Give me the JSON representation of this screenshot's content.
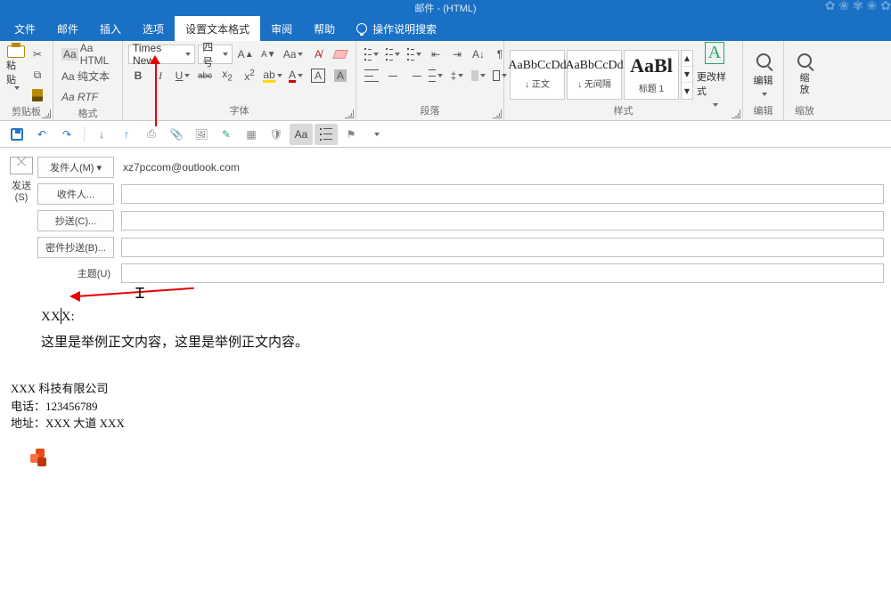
{
  "window": {
    "title": "邮件 - (HTML)"
  },
  "tabs": {
    "file": "文件",
    "mail": "邮件",
    "insert": "插入",
    "options": "选项",
    "format": "设置文本格式",
    "review": "审阅",
    "help": "帮助",
    "tellme": "操作说明搜索"
  },
  "ribbon": {
    "clipboard": {
      "name": "剪贴板",
      "paste": "粘贴",
      "aa_html": "Aa HTML",
      "aa_plain": "Aa 纯文本",
      "aa_rtf": "Aa RTF"
    },
    "format_box": {
      "name": "格式"
    },
    "font": {
      "name": "字体",
      "family": "Times New",
      "size": "四号",
      "grow": "A↑",
      "shrink": "A↓",
      "changecase": "Aa",
      "clear": "⌫",
      "bold": "B",
      "italic": "I",
      "underline": "U",
      "strike": "abc",
      "sub": "x₂",
      "sup": "x²",
      "charborder": "A",
      "charshade": "A"
    },
    "para": {
      "name": "段落"
    },
    "styles": {
      "name": "样式",
      "card_sample": "AaBbCcDd",
      "card1": "↓ 正文",
      "card2": "↓ 无间隔",
      "card3_sample": "AaBl",
      "card3": "标题 1",
      "change": "更改样式"
    },
    "editing": {
      "name": "编辑",
      "label": "编辑"
    },
    "zoom": {
      "name": "缩放",
      "label": "缩\n放"
    }
  },
  "compose": {
    "send": "发送\n(S)",
    "from_btn": "发件人(M) ▾",
    "from_addr": "xz7pccom@outlook.com",
    "to_btn": "收件人...",
    "cc_btn": "抄送(C)...",
    "bcc_btn": "密件抄送(B)...",
    "subject_lbl": "主题(U)"
  },
  "body": {
    "greet_pre": "XX",
    "greet_post": "X:",
    "para1": "这里是举例正文内容，这里是举例正文内容。",
    "sig_company": "XXX 科技有限公司",
    "sig_phone": "电话：123456789",
    "sig_addr": "地址：XXX 大道 XXX"
  }
}
